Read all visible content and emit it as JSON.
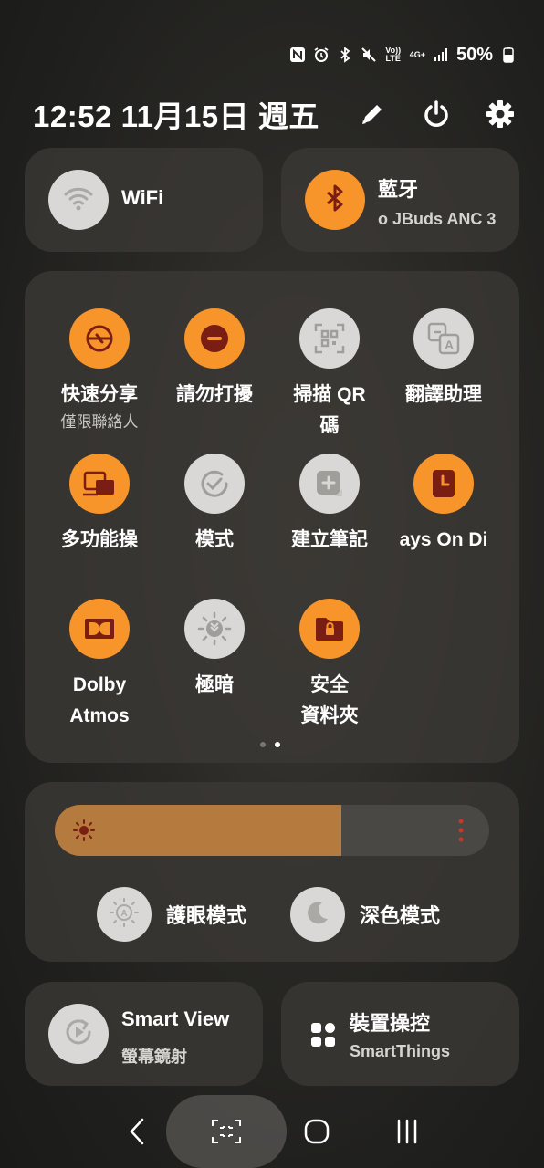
{
  "status_bar": {
    "icons": [
      "nfc-icon",
      "alarm-icon",
      "bluetooth-icon",
      "mute-icon",
      "volte-icon",
      "4g-icon",
      "signal-icon"
    ],
    "volte_label": "Vo)) LTE",
    "net_label": "4G+",
    "battery": "50%"
  },
  "header": {
    "datetime": "12:52  11月15日 週五",
    "icons": [
      "edit-icon",
      "power-icon",
      "settings-icon"
    ]
  },
  "wifi": {
    "label": "WiFi",
    "state": "off"
  },
  "bluetooth": {
    "label": "藍牙",
    "sub": "o JBuds ANC 3",
    "state": "on"
  },
  "quick_tiles": [
    {
      "label": "快速分享",
      "sub": "僅限聯絡人",
      "icon": "quick-share-icon",
      "state": "on"
    },
    {
      "label": "請勿打擾",
      "icon": "do-not-disturb-icon",
      "state": "on"
    },
    {
      "label": "掃描 QR",
      "label2": "碼",
      "icon": "qr-scan-icon",
      "state": "off"
    },
    {
      "label": "翻譯助理",
      "icon": "translate-icon",
      "state": "off"
    },
    {
      "label": "多功能操",
      "icon": "multi-control-icon",
      "state": "on"
    },
    {
      "label": "模式",
      "icon": "modes-icon",
      "state": "off"
    },
    {
      "label": "建立筆記",
      "icon": "create-note-icon",
      "state": "off"
    },
    {
      "label": "ays On Di",
      "icon": "always-on-display-icon",
      "state": "on"
    },
    {
      "label": "Dolby",
      "label2": "Atmos",
      "icon": "dolby-icon",
      "state": "on"
    },
    {
      "label": "極暗",
      "icon": "extra-dim-icon",
      "state": "off"
    },
    {
      "label": "安全",
      "label2": "資料夾",
      "icon": "secure-folder-icon",
      "state": "on"
    }
  ],
  "page_indicator": {
    "pages": 2,
    "current": 2
  },
  "brightness": {
    "level": 0.66,
    "icon": "brightness-icon"
  },
  "eye_comfort": {
    "label": "護眼模式",
    "icon": "eye-comfort-icon"
  },
  "dark_mode": {
    "label": "深色模式",
    "icon": "dark-mode-icon"
  },
  "smart_view": {
    "label": "Smart View",
    "sub": "螢幕鏡射",
    "icon": "smart-view-icon"
  },
  "device_control": {
    "label": "裝置操控",
    "sub": "SmartThings",
    "icon": "device-control-icon"
  },
  "nav": {
    "icons": [
      "back-icon",
      "capture-icon",
      "home-icon",
      "recents-icon"
    ]
  },
  "colors": {
    "accent": "#f7942a",
    "off_tile": "#d9d8d6",
    "icon_dark": "#7a1d12",
    "slider_fill": "#b47a3e"
  }
}
